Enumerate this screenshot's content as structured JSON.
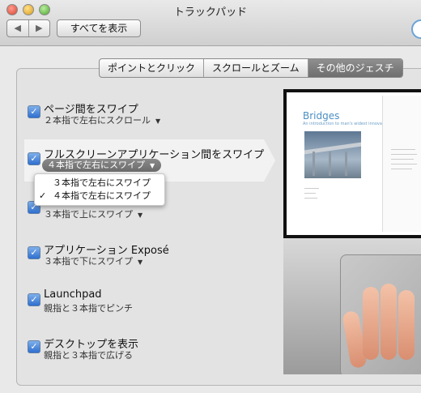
{
  "window": {
    "title": "トラックパッド"
  },
  "toolbar": {
    "back_label": "◀",
    "forward_label": "▶",
    "show_all_label": "すべてを表示"
  },
  "tabs": [
    {
      "label": "ポイントとクリック",
      "active": false
    },
    {
      "label": "スクロールとズーム",
      "active": false
    },
    {
      "label": "その他のジェスチ",
      "active": true
    }
  ],
  "settings": [
    {
      "title": "ページ間をスワイプ",
      "subtitle": "２本指で左右にスクロール",
      "checked": true,
      "has_popup": true
    },
    {
      "title": "フルスクリーンアプリケーション間をスワイプ",
      "subtitle": "４本指で左右にスワイプ",
      "checked": true,
      "has_popup": true
    },
    {
      "title": "",
      "subtitle": "３本指で上にスワイプ",
      "checked": true,
      "has_popup": true
    },
    {
      "title": "アプリケーション Exposé",
      "subtitle": "３本指で下にスワイプ",
      "checked": true,
      "has_popup": true
    },
    {
      "title": "Launchpad",
      "subtitle": "親指と３本指でピンチ",
      "checked": true,
      "has_popup": false
    },
    {
      "title": "デスクトップを表示",
      "subtitle": "親指と３本指で広げる",
      "checked": true,
      "has_popup": false
    }
  ],
  "popup_menu": {
    "items": [
      {
        "label": "３本指で左右にスワイプ",
        "checked": false
      },
      {
        "label": "４本指で左右にスワイプ",
        "checked": true
      }
    ]
  },
  "preview": {
    "doc_title": "Bridges",
    "doc_subtitle": "An introduction to man's widest innovation"
  },
  "colors": {
    "accent": "#2f6fcf",
    "link": "#4b8fc4"
  }
}
